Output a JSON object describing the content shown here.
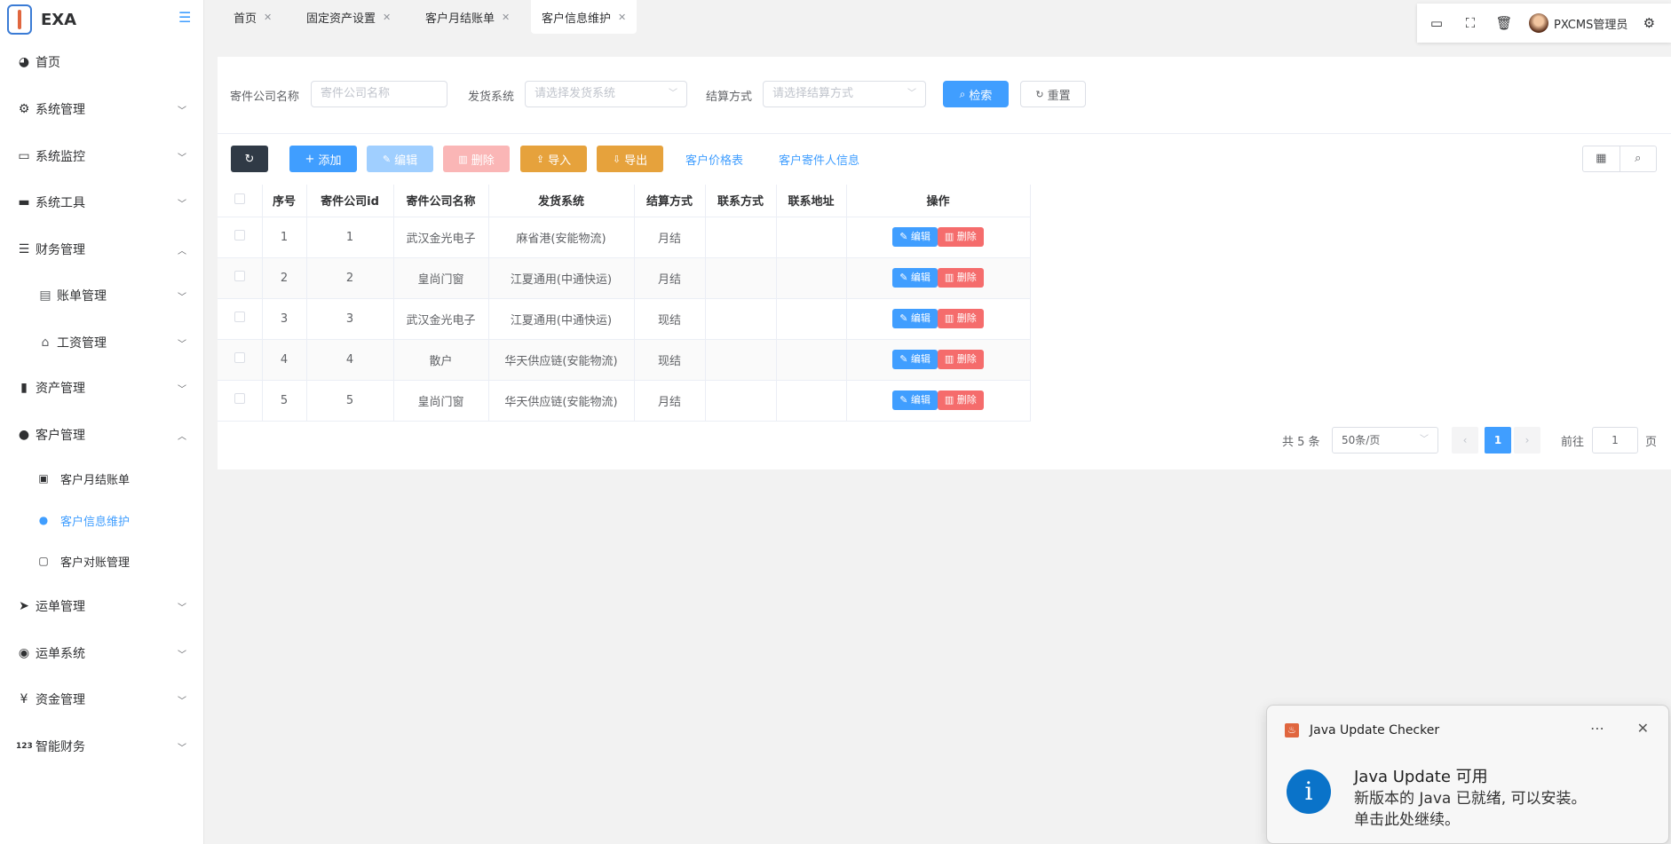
{
  "sidebar": {
    "logo_text": "EXA",
    "menu": [
      {
        "icon": "dashboard-icon",
        "glyph": "◕",
        "label": "首页"
      },
      {
        "icon": "gear-icon",
        "glyph": "⚙",
        "label": "系统管理"
      },
      {
        "icon": "monitor-icon",
        "glyph": "▭",
        "label": "系统监控"
      },
      {
        "icon": "toolbox-icon",
        "glyph": "▬",
        "label": "系统工具"
      },
      {
        "icon": "list-tree-icon",
        "glyph": "☰",
        "label": "财务管理"
      },
      {
        "icon": "document-icon",
        "glyph": "▤",
        "label": "账单管理"
      },
      {
        "icon": "bell-icon",
        "glyph": "⌂",
        "label": "工资管理"
      },
      {
        "icon": "bar-chart-icon",
        "glyph": "▮",
        "label": "资产管理"
      },
      {
        "icon": "user-icon",
        "glyph": "●",
        "label": "客户管理"
      },
      {
        "icon": "clipboard-icon",
        "glyph": "▣",
        "label": "客户月结账单"
      },
      {
        "icon": "user-icon",
        "glyph": "●",
        "label": "客户信息维护"
      },
      {
        "icon": "chat-icon",
        "glyph": "▢",
        "label": "客户对账管理"
      },
      {
        "icon": "send-icon",
        "glyph": "➤",
        "label": "运单管理"
      },
      {
        "icon": "globe-icon",
        "glyph": "◉",
        "label": "运单系统"
      },
      {
        "icon": "yen-icon",
        "glyph": "¥",
        "label": "资金管理"
      },
      {
        "icon": "numbers-icon",
        "glyph": "123",
        "label": "智能财务"
      }
    ]
  },
  "tabs": [
    {
      "label": "首页"
    },
    {
      "label": "固定资产设置"
    },
    {
      "label": "客户月结账单"
    },
    {
      "label": "客户信息维护"
    }
  ],
  "header": {
    "username": "PXCMS管理员"
  },
  "search": {
    "company_label": "寄件公司名称",
    "company_placeholder": "寄件公司名称",
    "system_label": "发货系统",
    "system_placeholder": "请选择发货系统",
    "settle_label": "结算方式",
    "settle_placeholder": "请选择结算方式",
    "search_btn": "检索",
    "reset_btn": "重置"
  },
  "toolbar": {
    "add": "添加",
    "edit": "编辑",
    "delete": "删除",
    "import": "导入",
    "export": "导出",
    "price_link": "客户价格表",
    "sender_link": "客户寄件人信息"
  },
  "table": {
    "columns": [
      "序号",
      "寄件公司id",
      "寄件公司名称",
      "发货系统",
      "结算方式",
      "联系方式",
      "联系地址",
      "操作"
    ],
    "rows": [
      [
        "1",
        "1",
        "武汉金光电子",
        "麻省港(安能物流)",
        "月结",
        "",
        ""
      ],
      [
        "2",
        "2",
        "皇尚门窗",
        "江夏通用(中通快运)",
        "月结",
        "",
        ""
      ],
      [
        "3",
        "3",
        "武汉金光电子",
        "江夏通用(中通快运)",
        "现结",
        "",
        ""
      ],
      [
        "4",
        "4",
        "散户",
        "华天供应链(安能物流)",
        "现结",
        "",
        ""
      ],
      [
        "5",
        "5",
        "皇尚门窗",
        "华天供应链(安能物流)",
        "月结",
        "",
        ""
      ]
    ],
    "row_edit": "编辑",
    "row_delete": "删除"
  },
  "pagination": {
    "total": "共 5 条",
    "page_size": "50条/页",
    "current": "1",
    "goto_label": "前往",
    "goto_value": "1",
    "page_suffix": "页"
  },
  "notification": {
    "app": "Java Update Checker",
    "title": "Java Update 可用",
    "line1": "新版本的 Java 已就绪, 可以安装。",
    "line2": "单击此处继续。"
  }
}
